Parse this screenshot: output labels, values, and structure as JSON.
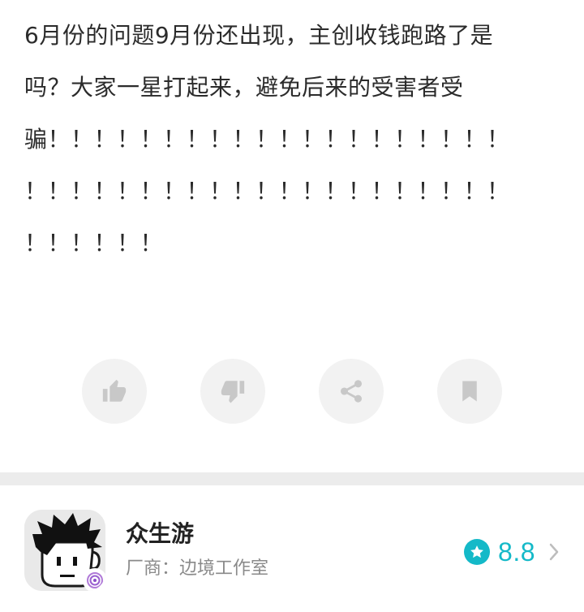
{
  "review": {
    "lines": [
      "6月份的问题9月份还出现，主创收钱跑路了是",
      "吗？大家一星打起来，避免后来的受害者受",
      "骗！！！！！！！！！！！！！！！！！！！！",
      "！！！！！！！！！！！！！！！！！！！！！",
      "！！！！！！"
    ]
  },
  "actions": [
    {
      "name": "like",
      "icon": "thumbs-up-icon"
    },
    {
      "name": "dislike",
      "icon": "thumbs-down-icon"
    },
    {
      "name": "share",
      "icon": "share-icon"
    },
    {
      "name": "bookmark",
      "icon": "bookmark-icon"
    }
  ],
  "game": {
    "name": "众生游",
    "vendor_label": "厂商：",
    "vendor": "边境工作室",
    "rating": "8.8",
    "icon": "game-avatar-icon"
  },
  "colors": {
    "accent": "#14b9c8",
    "action_bg": "#f2f2f2",
    "icon_gray": "#c8c8c8",
    "divider": "#ececec"
  }
}
